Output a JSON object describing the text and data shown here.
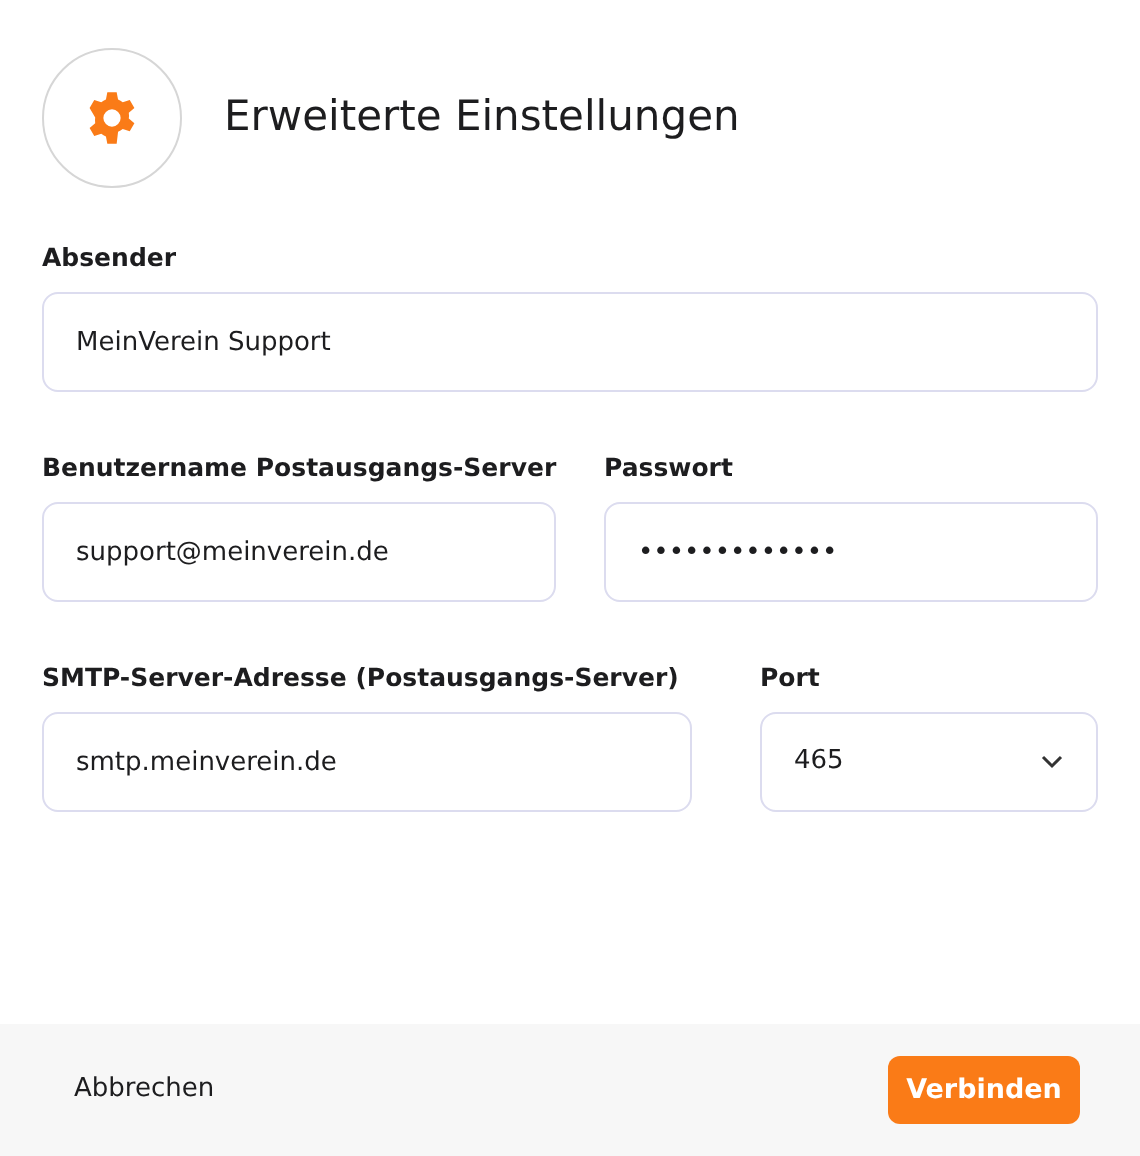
{
  "dialog": {
    "title": "Erweiterte Einstellungen"
  },
  "rows": [
    {
      "fields": [
        {
          "label": "Absender",
          "kind": "text",
          "value": "MeinVerein Support"
        }
      ]
    },
    {
      "fields": [
        {
          "label": "Benutzername Postausgangs-Server",
          "kind": "text",
          "value": "support@meinverein.de"
        },
        {
          "label": "Passwort",
          "kind": "password",
          "value": "•••••••••••••"
        }
      ]
    },
    {
      "fields": [
        {
          "label": "SMTP-Server-Adresse (Postausgangs-Server)",
          "kind": "text",
          "value": "smtp.meinverein.de"
        },
        {
          "label": "Port",
          "kind": "select",
          "value": "465"
        }
      ]
    }
  ],
  "footer": {
    "cancel": "Abbrechen",
    "confirm": "Verbinden"
  }
}
